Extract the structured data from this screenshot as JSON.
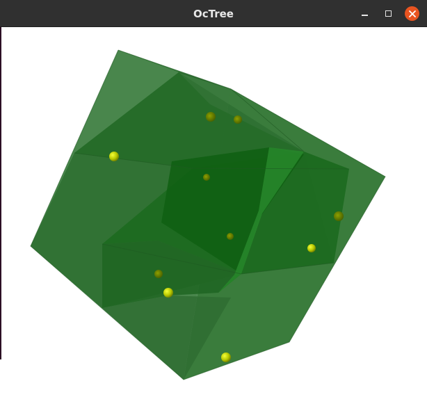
{
  "window": {
    "title": "OcTree"
  },
  "titlebar_buttons": {
    "minimize": "minimize-icon",
    "maximize": "maximize-icon",
    "close": "close-icon"
  },
  "colors": {
    "titlebar": "#303030",
    "close_button": "#e95420",
    "cube_face": "#2e7d32",
    "point": "#c8d400"
  }
}
